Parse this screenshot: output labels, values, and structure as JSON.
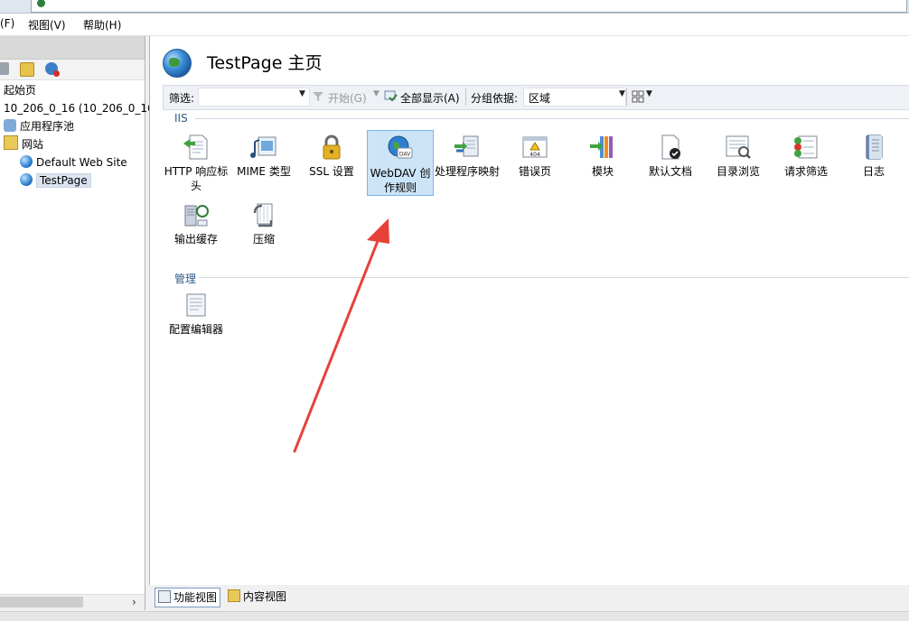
{
  "menu": {
    "file": "(F)",
    "view": "视图(V)",
    "help": "帮助(H)"
  },
  "tree": {
    "start_page": "起始页",
    "server": "10_206_0_16 (10_206_0_16\\",
    "app_pools": "应用程序池",
    "sites": "网站",
    "site1": "Default Web Site",
    "site2": "TestPage"
  },
  "main": {
    "title": "TestPage 主页",
    "filter_label": "筛选:",
    "start_label": "开始(G)",
    "show_all_label": "全部显示(A)",
    "group_by_label": "分组依据:",
    "group_by_value": "区域"
  },
  "groups": [
    {
      "name": "IIS",
      "features": [
        {
          "label": "HTTP 响应标头",
          "icon": "http-headers-icon"
        },
        {
          "label": "MIME 类型",
          "icon": "mime-types-icon"
        },
        {
          "label": "SSL 设置",
          "icon": "lock-icon"
        },
        {
          "label": "WebDAV 创作规则",
          "icon": "webdav-globe-icon"
        },
        {
          "label": "处理程序映射",
          "icon": "handler-mappings-icon"
        },
        {
          "label": "错误页",
          "icon": "error-404-icon"
        },
        {
          "label": "模块",
          "icon": "modules-icon"
        },
        {
          "label": "默认文档",
          "icon": "default-document-icon"
        },
        {
          "label": "目录浏览",
          "icon": "directory-browsing-icon"
        },
        {
          "label": "请求筛选",
          "icon": "request-filtering-icon"
        },
        {
          "label": "日志",
          "icon": "logging-icon"
        },
        {
          "label": "输出缓存",
          "icon": "output-cache-icon"
        },
        {
          "label": "压缩",
          "icon": "compression-icon"
        }
      ]
    },
    {
      "name": "管理",
      "features": [
        {
          "label": "配置编辑器",
          "icon": "config-editor-icon"
        }
      ]
    }
  ],
  "bottom": {
    "features_view": "功能视图",
    "content_view": "内容视图"
  },
  "colors": {
    "selection": "#cce4f7",
    "selection_border": "#7eb4ea",
    "arrow": "#e8413a",
    "group_text": "#2e5a8a"
  }
}
